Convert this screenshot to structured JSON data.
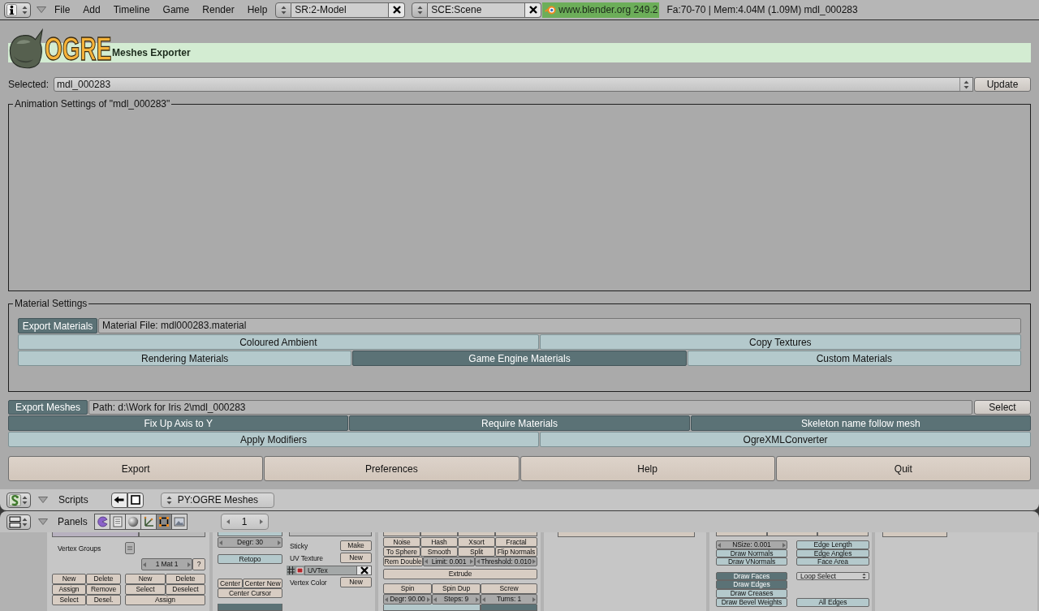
{
  "top_bar": {
    "menus": [
      "File",
      "Add",
      "Timeline",
      "Game",
      "Render",
      "Help"
    ],
    "screen_field": "SR:2-Model",
    "scene_field": "SCE:Scene",
    "version": "www.blender.org 249.2",
    "stats": "Fa:70-70 | Mem:4.04M (1.09M) mdl_000283"
  },
  "exporter": {
    "logo_text": "OGRE",
    "title": "Meshes Exporter",
    "selected_label": "Selected:",
    "selected_value": "mdl_000283",
    "update_button": "Update",
    "animation_settings": {
      "title": "Animation Settings of \"mdl_000283\""
    },
    "material_settings": {
      "title": "Material Settings",
      "export_toggle": {
        "label": "Export Materials",
        "on": true
      },
      "file_field": "Material File: mdl000283.material",
      "rows": [
        [
          {
            "label": "Coloured Ambient",
            "on": false
          },
          {
            "label": "Copy Textures",
            "on": false
          }
        ],
        [
          {
            "label": "Rendering Materials",
            "on": false
          },
          {
            "label": "Game Engine Materials",
            "on": true
          },
          {
            "label": "Custom Materials",
            "on": false
          }
        ]
      ]
    },
    "mesh_settings": {
      "export_toggle": {
        "label": "Export Meshes",
        "on": true
      },
      "path_field": "Path: d:\\Work for Iris 2\\mdl_000283",
      "select_button": "Select",
      "rows": [
        [
          {
            "label": "Fix Up Axis to Y",
            "on": true
          },
          {
            "label": "Require Materials",
            "on": true
          },
          {
            "label": "Skeleton name follow mesh",
            "on": true
          }
        ],
        [
          {
            "label": "Apply Modifiers",
            "on": false
          },
          {
            "label": "OgreXMLConverter",
            "on": false
          }
        ]
      ]
    },
    "actions": [
      "Export",
      "Preferences",
      "Help",
      "Quit"
    ]
  },
  "scripts_header": {
    "label": "Scripts",
    "script_menu": "PY:OGRE Meshes"
  },
  "panels_header": {
    "label": "Panels",
    "tabs": [
      {
        "selected": false
      },
      {
        "selected": false
      },
      {
        "selected": false
      },
      {
        "selected": false
      },
      {
        "selected": true
      },
      {
        "selected": false
      }
    ],
    "frame_field": "1"
  },
  "button_panels": [
    {
      "columns": [
        {
          "rows": [
            {
              "items": [
                {
                  "kind": "label",
                  "label": "Vertex Groups"
                },
                {
                  "kind": "icon_menu"
                }
              ]
            },
            {
              "items": [
                {
                  "kind": "number",
                  "label": "1 Mat 1"
                },
                {
                  "kind": "button",
                  "label": "?"
                }
              ]
            },
            {
              "items": [
                {
                  "kind": "button",
                  "label": "New"
                },
                {
                  "kind": "button",
                  "label": "Delete"
                },
                {
                  "kind": "button",
                  "label": "New"
                },
                {
                  "kind": "button",
                  "label": "Delete"
                }
              ]
            },
            {
              "items": [
                {
                  "kind": "button",
                  "label": "Assign"
                },
                {
                  "kind": "button",
                  "label": "Remove"
                },
                {
                  "kind": "button",
                  "label": "Select"
                },
                {
                  "kind": "button",
                  "label": "Deselect"
                }
              ]
            },
            {
              "items": [
                {
                  "kind": "button",
                  "label": "Select"
                },
                {
                  "kind": "button",
                  "label": "Desel."
                },
                {
                  "kind": "button",
                  "label": "Assign"
                }
              ]
            }
          ]
        }
      ]
    },
    {
      "columns": [
        {
          "rows": [
            {
              "items": [
                {
                  "kind": "number",
                  "label": "Degr: 30"
                }
              ]
            },
            {
              "items": [
                {
                  "kind": "toggle",
                  "label": "Retopo",
                  "on": false
                }
              ]
            },
            {
              "items": [
                {
                  "kind": "button",
                  "label": "Center"
                },
                {
                  "kind": "button",
                  "label": "Center New"
                }
              ]
            },
            {
              "items": [
                {
                  "kind": "button",
                  "label": "Center Cursor"
                }
              ]
            }
          ]
        },
        {
          "rows": [
            {
              "items": [
                {
                  "kind": "label",
                  "label": "Sticky"
                },
                {
                  "kind": "button",
                  "label": "Make"
                }
              ]
            },
            {
              "items": [
                {
                  "kind": "label",
                  "label": "UV Texture"
                },
                {
                  "kind": "button",
                  "label": "New"
                }
              ]
            },
            {
              "items": [
                {
                  "kind": "uv_layer",
                  "label": "UVTex"
                }
              ]
            },
            {
              "items": [
                {
                  "kind": "label",
                  "label": "Vertex Color"
                },
                {
                  "kind": "button",
                  "label": "New"
                }
              ]
            }
          ]
        }
      ]
    },
    {
      "columns": [
        {
          "rows": [
            {
              "items": [
                {
                  "kind": "button",
                  "label": "Noise"
                },
                {
                  "kind": "button",
                  "label": "Hash"
                },
                {
                  "kind": "button",
                  "label": "Xsort"
                },
                {
                  "kind": "button",
                  "label": "Fractal"
                }
              ]
            },
            {
              "items": [
                {
                  "kind": "button",
                  "label": "To Sphere"
                },
                {
                  "kind": "button",
                  "label": "Smooth"
                },
                {
                  "kind": "button",
                  "label": "Split"
                },
                {
                  "kind": "button",
                  "label": "Flip Normals"
                }
              ]
            },
            {
              "items": [
                {
                  "kind": "button",
                  "label": "Rem Double"
                },
                {
                  "kind": "number",
                  "label": "Limit: 0.001"
                },
                {
                  "kind": "number",
                  "label": "Threshold: 0.010"
                }
              ]
            },
            {
              "items": [
                {
                  "kind": "button",
                  "label": "Extrude"
                }
              ]
            },
            {
              "items": [
                {
                  "kind": "button",
                  "label": "Spin"
                },
                {
                  "kind": "button",
                  "label": "Spin Dup"
                },
                {
                  "kind": "button",
                  "label": "Screw"
                }
              ]
            },
            {
              "items": [
                {
                  "kind": "number",
                  "label": "Degr: 90.00"
                },
                {
                  "kind": "number",
                  "label": "Steps: 9"
                },
                {
                  "kind": "number",
                  "label": "Turns: 1"
                }
              ]
            }
          ]
        }
      ]
    },
    {
      "columns": [
        {
          "rows": [
            {
              "items": [
                {
                  "kind": "number",
                  "label": "NSize: 0.001"
                },
                {
                  "kind": "toggle",
                  "label": "Edge Length",
                  "on": false
                }
              ]
            },
            {
              "items": [
                {
                  "kind": "toggle",
                  "label": "Draw Normals",
                  "on": false
                },
                {
                  "kind": "toggle",
                  "label": "Edge Angles",
                  "on": false
                }
              ]
            },
            {
              "items": [
                {
                  "kind": "toggle",
                  "label": "Draw VNormals",
                  "on": false
                },
                {
                  "kind": "toggle",
                  "label": "Face Area",
                  "on": false
                }
              ]
            },
            {
              "items": [
                {
                  "kind": "toggle",
                  "label": "Draw Faces",
                  "on": true
                },
                {
                  "kind": "menu",
                  "label": "Loop Select"
                }
              ]
            },
            {
              "items": [
                {
                  "kind": "toggle",
                  "label": "Draw Edges",
                  "on": true
                }
              ]
            },
            {
              "items": [
                {
                  "kind": "toggle",
                  "label": "Draw Creases",
                  "on": false
                }
              ]
            },
            {
              "items": [
                {
                  "kind": "toggle",
                  "label": "Draw Bevel Weights",
                  "on": false
                },
                {
                  "kind": "toggle",
                  "label": "All Edges",
                  "on": false
                }
              ]
            }
          ]
        }
      ]
    }
  ]
}
